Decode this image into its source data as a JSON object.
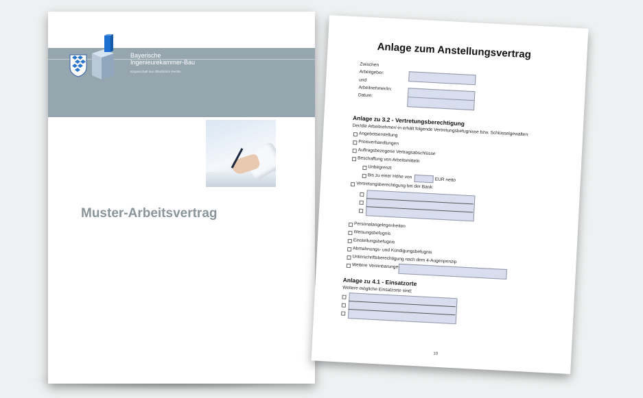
{
  "cover": {
    "org_line1": "Bayerische",
    "org_line2": "Ingenieurekammer-Bau",
    "org_sub": "Körperschaft des öffentlichen Rechts",
    "title": "Muster-Arbeitsvertrag",
    "band_color": "#95a6ae",
    "logo_icon": "bavarian-lozenge-and-cube-logo",
    "photo_icon": "hand-signing-document-photo"
  },
  "page": {
    "title": "Anlage zum Anstellungsvertrag",
    "header_fields": {
      "zwischen": "Zwischen",
      "arbeitgeber": "Arbeitgeber:",
      "und": "und",
      "arbeitnehmer": "Arbeitnehmer/in:",
      "datum": "Datum:"
    },
    "section1": {
      "heading": "Anlage zu 3.2 - Vertretungsberechtigung",
      "intro": "Der/die Arbeitnehmer/-in erhält folgende Vertretungsbefugnisse bzw. Schlüsselgewalten:",
      "items": [
        "Angebotserstellung",
        "Preisverhandlungen",
        "Auftragsbezogene Vertragsabschlüsse",
        "Beschaffung von Arbeitsmitteln"
      ],
      "sub_items": {
        "unbegrenzt": "Unbegrenzt",
        "bis_prefix": "Bis zu einer Höhe von",
        "bis_suffix": "EUR netto"
      },
      "bank": "Vertretungsberechtigung bei der Bank:",
      "items2": [
        "Personalangelegenheiten",
        "Weisungsbefugnis",
        "Einstellungsbefugnis",
        "Abmahnungs- und Kündigungsbefugnis",
        "Unterschriftsberechtigung nach dem 4-Augenprinzip",
        "Weitere Vereinbarungen:"
      ]
    },
    "section2": {
      "heading": "Anlage zu 4.1 - Einsatzorte",
      "intro": "Weitere mögliche Einsatzorte sind:"
    },
    "page_number": "10",
    "field_color": "#d9deee"
  }
}
